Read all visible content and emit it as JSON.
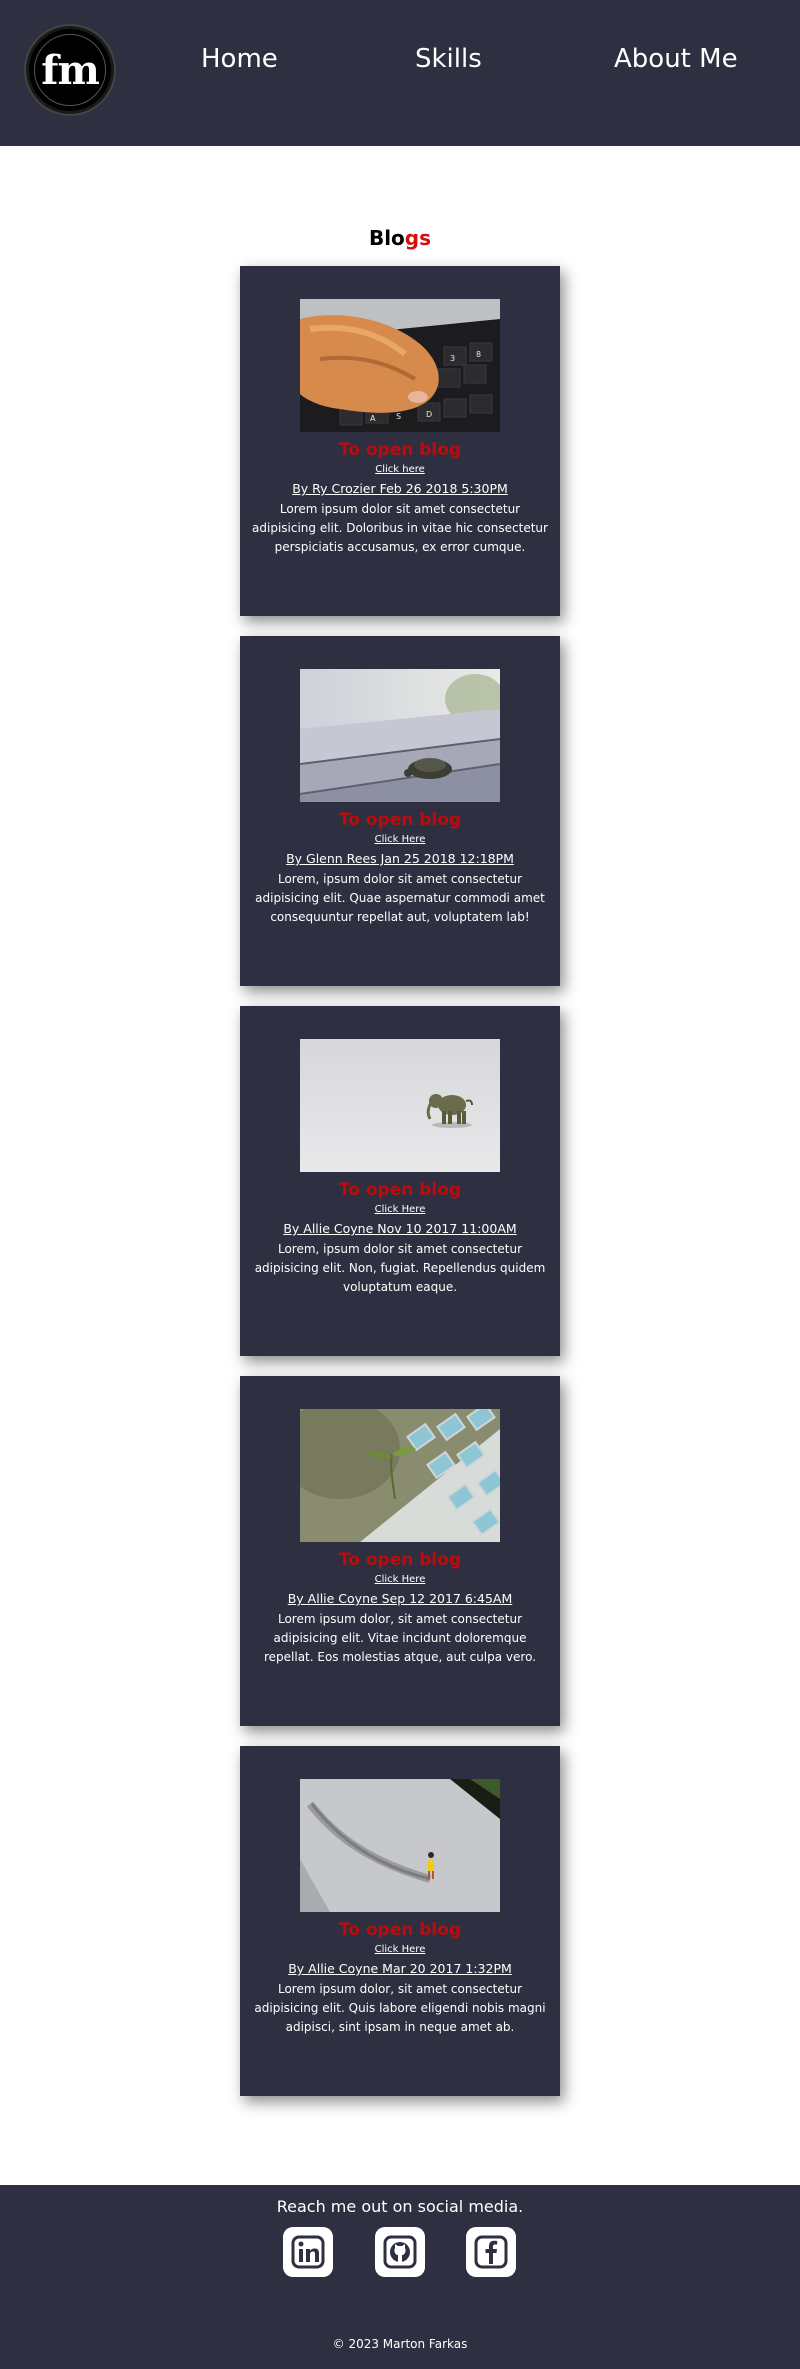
{
  "header": {
    "logo_text": "fm",
    "nav": [
      "Home",
      "Skills",
      "About Me"
    ]
  },
  "blogs": {
    "title_main": "Blo",
    "title_accent": "gs",
    "posts": [
      {
        "heading": "To open blog",
        "click": "Click here",
        "author": "By Ry Crozier Feb 26 2018 5:30PM",
        "body": "Lorem ipsum dolor sit amet consectetur adipisicing elit. Doloribus in vitae hic consectetur perspiciatis accusamus, ex error cumque.",
        "image": "cat-paw-on-keyboard"
      },
      {
        "heading": "To open blog",
        "click": "Click Here",
        "author": "By Glenn Rees Jan 25 2018 12:18PM",
        "body": "Lorem, ipsum dolor sit amet consectetur adipisicing elit. Quae aspernatur commodi amet consequuntur repellat aut, voluptatem lab!",
        "image": "turtle-on-bench"
      },
      {
        "heading": "To open blog",
        "click": "Click Here",
        "author": "By Allie Coyne Nov 10 2017 11:00AM",
        "body": "Lorem, ipsum dolor sit amet consectetur adipisicing elit. Non, fugiat. Repellendus quidem voluptatum eaque.",
        "image": "toy-elephant"
      },
      {
        "heading": "To open blog",
        "click": "Click Here",
        "author": "By Allie Coyne Sep 12 2017 6:45AM",
        "body": "Lorem ipsum dolor, sit amet consectetur adipisicing elit. Vitae incidunt doloremque repellat. Eos molestias atque, aut culpa vero.",
        "image": "sprout-on-tiles"
      },
      {
        "heading": "To open blog",
        "click": "Click Here",
        "author": "By Allie Coyne Mar 20 2017 1:32PM",
        "body": "Lorem ipsum dolor, sit amet consectetur adipisicing elit. Quis labore eligendi nobis magni adipisci, sint ipsam in neque amet ab.",
        "image": "tiny-figure-shadow"
      }
    ]
  },
  "footer": {
    "text": "Reach me out on social media.",
    "social": [
      "linkedin-icon",
      "github-icon",
      "facebook-icon"
    ],
    "copyright": "© 2023 Marton Farkas"
  },
  "colors": {
    "header_bg": "#2e3041",
    "accent": "#d11010"
  }
}
